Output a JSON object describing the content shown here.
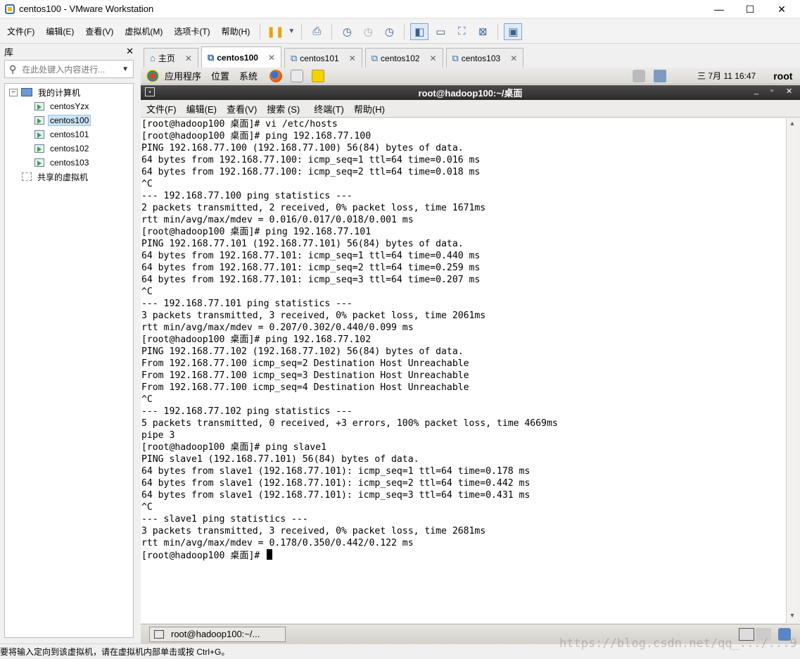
{
  "window": {
    "title": "centos100 - VMware Workstation",
    "minimize": "—",
    "maximize": "☐",
    "close": "✕"
  },
  "menubar": {
    "items": [
      "文件(F)",
      "编辑(E)",
      "查看(V)",
      "虚拟机(M)",
      "选项卡(T)",
      "帮助(H)"
    ]
  },
  "library": {
    "title": "库",
    "close": "✕",
    "search_placeholder": "在此处键入内容进行...",
    "tree": {
      "root": "我的计算机",
      "vms": [
        "centosYzx",
        "centos100",
        "centos101",
        "centos102",
        "centos103"
      ],
      "selected": "centos100",
      "shared": "共享的虚拟机"
    }
  },
  "tabs": [
    {
      "label": "主页",
      "active": false
    },
    {
      "label": "centos100",
      "active": true
    },
    {
      "label": "centos101",
      "active": false
    },
    {
      "label": "centos102",
      "active": false
    },
    {
      "label": "centos103",
      "active": false
    }
  ],
  "guest_panel": {
    "applications": "应用程序",
    "places": "位置",
    "system": "系统",
    "clock": "三 7月 11 16:47",
    "user": "root"
  },
  "terminal": {
    "title": "root@hadoop100:~/桌面",
    "menu": [
      "文件(F)",
      "编辑(E)",
      "查看(V)",
      "搜索 (S)",
      "终端(T)",
      "帮助(H)"
    ],
    "lines": [
      "[root@hadoop100 桌面]# vi /etc/hosts",
      "[root@hadoop100 桌面]# ping 192.168.77.100",
      "PING 192.168.77.100 (192.168.77.100) 56(84) bytes of data.",
      "64 bytes from 192.168.77.100: icmp_seq=1 ttl=64 time=0.016 ms",
      "64 bytes from 192.168.77.100: icmp_seq=2 ttl=64 time=0.018 ms",
      "^C",
      "--- 192.168.77.100 ping statistics ---",
      "2 packets transmitted, 2 received, 0% packet loss, time 1671ms",
      "rtt min/avg/max/mdev = 0.016/0.017/0.018/0.001 ms",
      "[root@hadoop100 桌面]# ping 192.168.77.101",
      "PING 192.168.77.101 (192.168.77.101) 56(84) bytes of data.",
      "64 bytes from 192.168.77.101: icmp_seq=1 ttl=64 time=0.440 ms",
      "64 bytes from 192.168.77.101: icmp_seq=2 ttl=64 time=0.259 ms",
      "64 bytes from 192.168.77.101: icmp_seq=3 ttl=64 time=0.207 ms",
      "^C",
      "--- 192.168.77.101 ping statistics ---",
      "3 packets transmitted, 3 received, 0% packet loss, time 2061ms",
      "rtt min/avg/max/mdev = 0.207/0.302/0.440/0.099 ms",
      "[root@hadoop100 桌面]# ping 192.168.77.102",
      "PING 192.168.77.102 (192.168.77.102) 56(84) bytes of data.",
      "From 192.168.77.100 icmp_seq=2 Destination Host Unreachable",
      "From 192.168.77.100 icmp_seq=3 Destination Host Unreachable",
      "From 192.168.77.100 icmp_seq=4 Destination Host Unreachable",
      "^C",
      "--- 192.168.77.102 ping statistics ---",
      "5 packets transmitted, 0 received, +3 errors, 100% packet loss, time 4669ms",
      "pipe 3",
      "[root@hadoop100 桌面]# ping slave1",
      "PING slave1 (192.168.77.101) 56(84) bytes of data.",
      "64 bytes from slave1 (192.168.77.101): icmp_seq=1 ttl=64 time=0.178 ms",
      "64 bytes from slave1 (192.168.77.101): icmp_seq=2 ttl=64 time=0.442 ms",
      "64 bytes from slave1 (192.168.77.101): icmp_seq=3 ttl=64 time=0.431 ms",
      "^C",
      "--- slave1 ping statistics ---",
      "3 packets transmitted, 3 received, 0% packet loss, time 2681ms",
      "rtt min/avg/max/mdev = 0.178/0.350/0.442/0.122 ms"
    ],
    "prompt": "[root@hadoop100 桌面]# "
  },
  "guest_taskbar": {
    "task_label": "root@hadoop100:~/..."
  },
  "statusbar": {
    "message": "要将输入定向到该虚拟机，请在虚拟机内部单击或按 Ctrl+G。",
    "watermark": "https://blog.csdn.net/qq_.../...9"
  },
  "colors": {
    "terminal_titlebar": "#2b2b2b",
    "selection": "#cde4f7",
    "accent": "#3a6ea5"
  }
}
